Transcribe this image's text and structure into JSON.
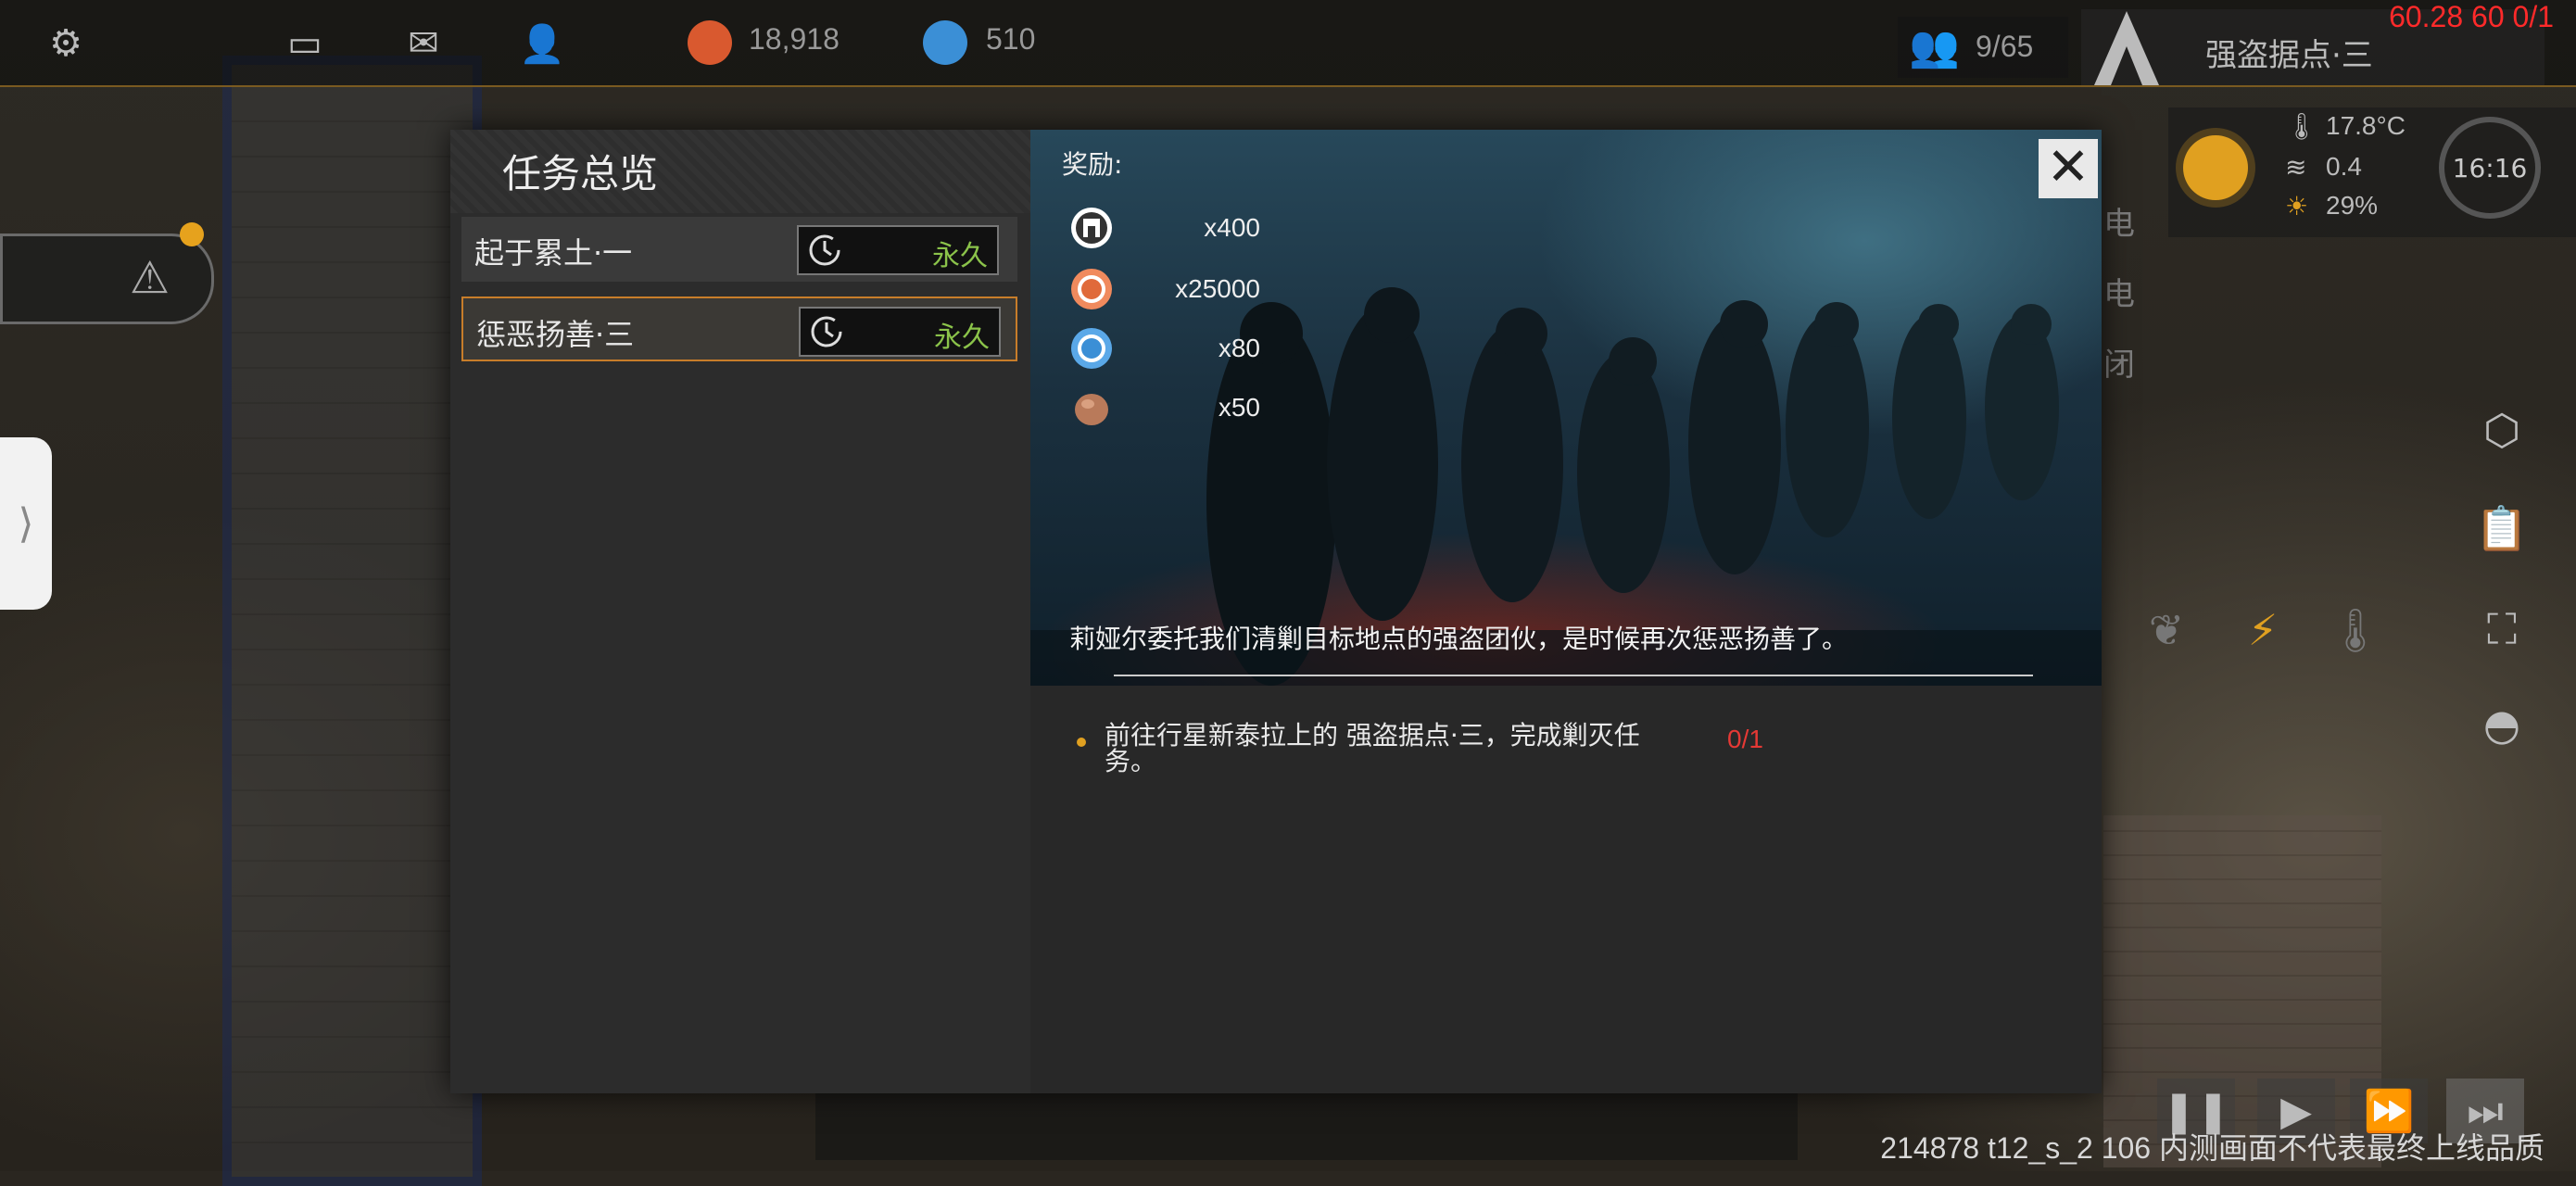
{
  "topbar": {
    "icons": [
      "gear-icon",
      "chat-icon",
      "mail-icon",
      "person-icon"
    ],
    "resource_a": {
      "icon": "red-coin-icon",
      "value": "18,918",
      "color": "#d9592f"
    },
    "resource_b": {
      "icon": "blue-coin-icon",
      "value": "510",
      "color": "#3b8fd6"
    },
    "population": "9/65",
    "location": "强盗据点·三",
    "fps_text": "60.28 60 0/1"
  },
  "weather": {
    "temperature": "17.8°C",
    "wind": "0.4",
    "sunlight": "29%",
    "clock": "16:16"
  },
  "modal": {
    "title": "任务总览",
    "quests": [
      {
        "name": "起于累土·一",
        "duration": "永久",
        "selected": false
      },
      {
        "name": "惩恶扬善·三",
        "duration": "永久",
        "selected": true
      }
    ],
    "rewards_label": "奖励:",
    "rewards": [
      {
        "icon": "tech-chip-icon",
        "qty": "x400"
      },
      {
        "icon": "red-coin-icon",
        "qty": "x25000"
      },
      {
        "icon": "blue-coin-icon",
        "qty": "x80"
      },
      {
        "icon": "ore-icon",
        "qty": "x50"
      }
    ],
    "description": "莉娅尔委托我们清剿目标地点的强盗团伙，是时候再次惩恶扬善了。",
    "objective": {
      "text": "前往行星新泰拉上的 强盗据点·三，完成剿灭任务。",
      "progress": "0/1"
    },
    "close_icon": "close-icon"
  },
  "side_labels": [
    "电",
    "电",
    "闭"
  ],
  "build_info": "214878 t12_s_2 106 内测画面不代表最终上线品质"
}
